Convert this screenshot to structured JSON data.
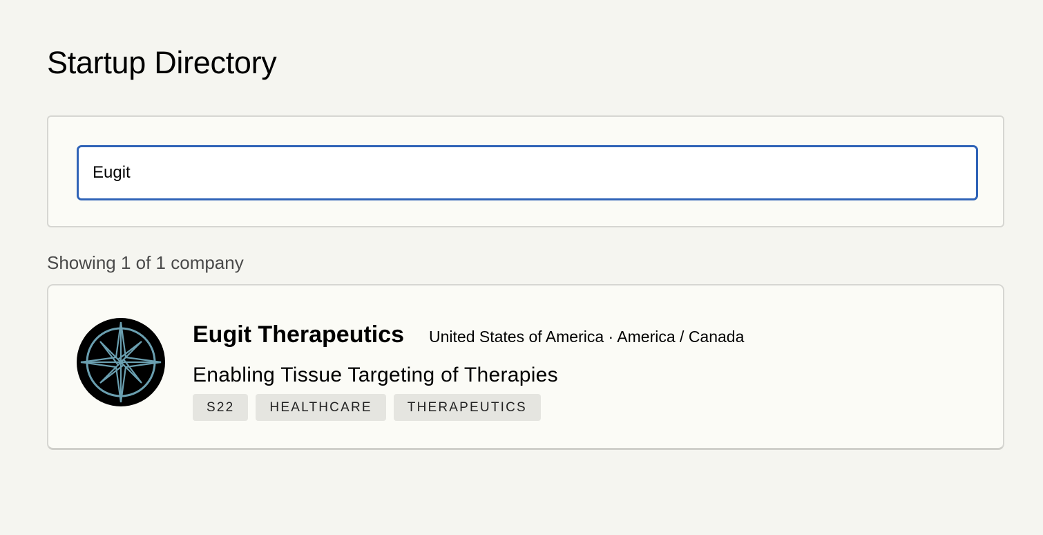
{
  "page": {
    "title": "Startup Directory"
  },
  "search": {
    "value": "Eugit",
    "accent_color": "#2f63b7"
  },
  "results": {
    "count_text": "Showing 1 of 1 company",
    "companies": [
      {
        "name": "Eugit Therapeutics",
        "location": "United States of America · America / Canada",
        "tagline": "Enabling Tissue Targeting of Therapies",
        "logo_icon": "compass-rose-icon",
        "tags": [
          "S22",
          "HEALTHCARE",
          "THERAPEUTICS"
        ]
      }
    ]
  }
}
